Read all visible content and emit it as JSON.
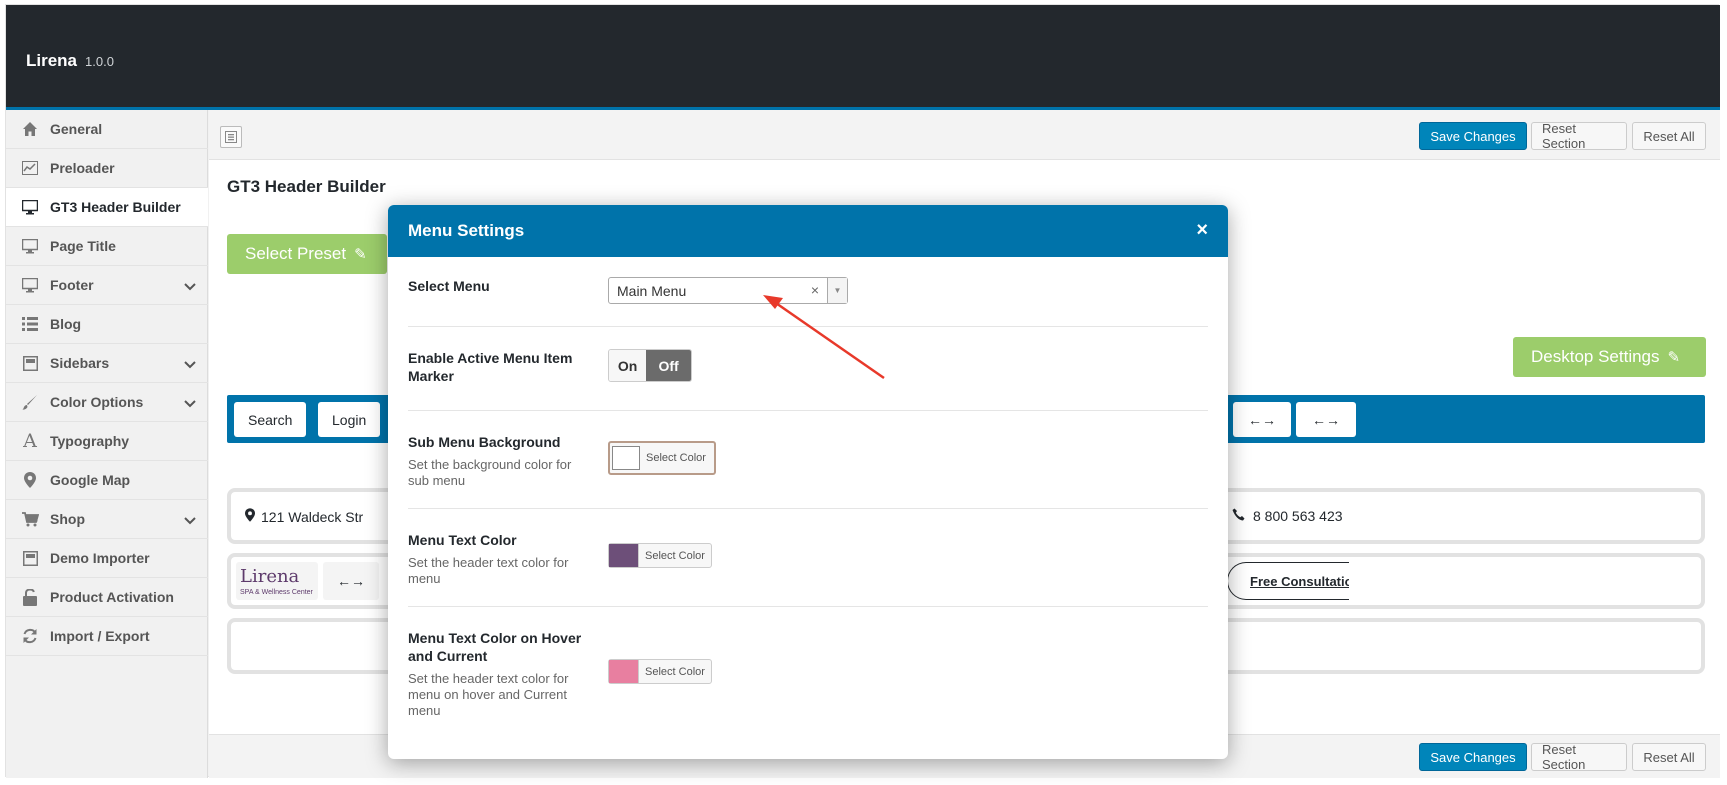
{
  "app": {
    "name": "Lirena",
    "version": "1.0.0"
  },
  "sidebar": {
    "items": [
      {
        "label": "General",
        "icon": "home-icon",
        "chevron": false,
        "active": false
      },
      {
        "label": "Preloader",
        "icon": "chart-icon",
        "chevron": false,
        "active": false
      },
      {
        "label": "GT3 Header Builder",
        "icon": "monitor-icon",
        "chevron": false,
        "active": true
      },
      {
        "label": "Page Title",
        "icon": "monitor-icon",
        "chevron": false,
        "active": false
      },
      {
        "label": "Footer",
        "icon": "monitor-icon",
        "chevron": true,
        "active": false
      },
      {
        "label": "Blog",
        "icon": "list-icon",
        "chevron": false,
        "active": false
      },
      {
        "label": "Sidebars",
        "icon": "layout-icon",
        "chevron": true,
        "active": false
      },
      {
        "label": "Color Options",
        "icon": "brush-icon",
        "chevron": true,
        "active": false
      },
      {
        "label": "Typography",
        "icon": "font-icon",
        "chevron": false,
        "active": false
      },
      {
        "label": "Google Map",
        "icon": "map-pin-icon",
        "chevron": false,
        "active": false
      },
      {
        "label": "Shop",
        "icon": "cart-icon",
        "chevron": true,
        "active": false
      },
      {
        "label": "Demo Importer",
        "icon": "layout-icon",
        "chevron": false,
        "active": false
      },
      {
        "label": "Product Activation",
        "icon": "unlock-icon",
        "chevron": false,
        "active": false
      },
      {
        "label": "Import / Export",
        "icon": "refresh-icon",
        "chevron": false,
        "active": false
      }
    ]
  },
  "toolbar": {
    "save_label": "Save Changes",
    "reset_section_label": "Reset Section",
    "reset_all_label": "Reset All"
  },
  "builder": {
    "title": "GT3 Header Builder",
    "select_preset_label": "Select Preset",
    "desktop_settings_label": "Desktop Settings",
    "top_chips": [
      "Search",
      "Login",
      "←→",
      "←→"
    ],
    "row1_left": "121 Waldeck Str",
    "row1_right": "8 800 563 423",
    "row2_logo": {
      "name": "Lirena",
      "tagline": "SPA & Wellness Center"
    },
    "row2_arrow": "←→",
    "row2_link": "Free Consultatio"
  },
  "modal": {
    "title": "Menu Settings",
    "close_label": "×",
    "fields": {
      "select_menu": {
        "label": "Select Menu",
        "value": "Main Menu",
        "clear": "×"
      },
      "active_marker": {
        "label": "Enable Active Menu Item Marker",
        "on": "On",
        "off": "Off",
        "value": "Off"
      },
      "submenu_bg": {
        "label": "Sub Menu Background",
        "desc": "Set the background color for sub menu",
        "button": "Select Color",
        "color": "#ffffff"
      },
      "text_color": {
        "label": "Menu Text Color",
        "desc": "Set the header text color for menu",
        "button": "Select Color",
        "color": "#6d4f79"
      },
      "hover_color": {
        "label": "Menu Text Color on Hover and Current",
        "desc": "Set the header text color for menu on hover and Current menu",
        "button": "Select Color",
        "color": "#e87fa0"
      }
    }
  },
  "colors": {
    "accent": "#0073aa",
    "green": "#9ccd6b",
    "header_bg": "#23282d",
    "annotation_arrow": "#e8392a"
  }
}
